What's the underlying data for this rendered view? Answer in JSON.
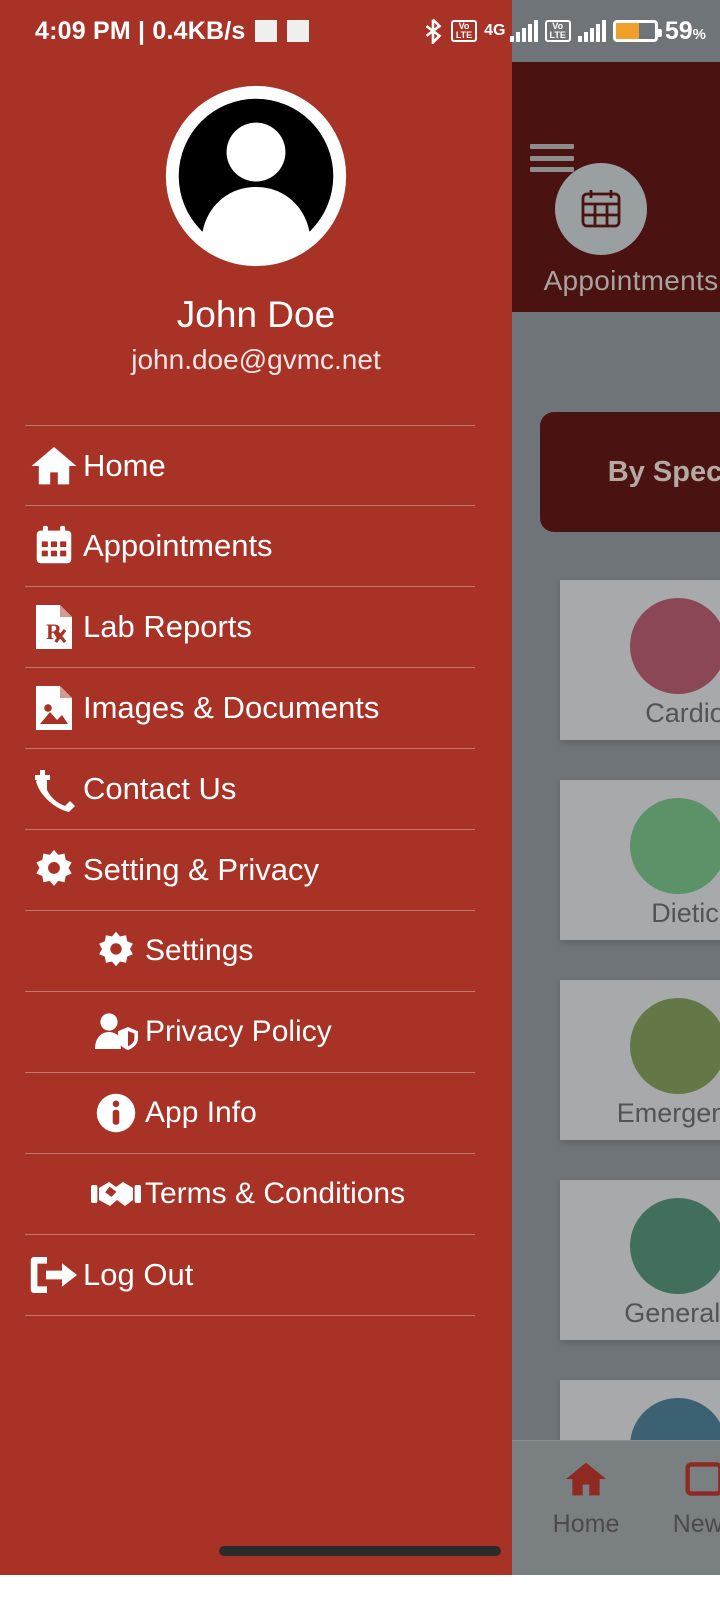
{
  "statusbar": {
    "time_and_speed": "4:09 PM | 0.4KB/s",
    "network_badge_1": "VoLTE",
    "network_gen": "4G",
    "network_badge_2": "VoLTE",
    "battery_percent": "59",
    "battery_percent_symbol": "%",
    "battery_level": 59,
    "bluetooth_icon": "bluetooth-icon"
  },
  "drawer": {
    "accent_color": "#a93226",
    "divider_color": "#c0776d",
    "profile": {
      "avatar": "user-avatar",
      "name": "John Doe",
      "email": "john.doe@gvmc.net"
    },
    "menu": [
      {
        "label": "Home",
        "icon": "home-icon",
        "sub": false
      },
      {
        "label": "Appointments",
        "icon": "calendar-icon",
        "sub": false
      },
      {
        "label": "Lab Reports",
        "icon": "prescription-icon",
        "sub": false
      },
      {
        "label": "Images & Documents",
        "icon": "image-file-icon",
        "sub": false
      },
      {
        "label": "Contact Us",
        "icon": "phone-plus-icon",
        "sub": false
      },
      {
        "label": "Setting & Privacy",
        "icon": "gear-icon",
        "sub": false
      },
      {
        "label": "Settings",
        "icon": "gear-icon",
        "sub": true
      },
      {
        "label": "Privacy Policy",
        "icon": "person-shield-icon",
        "sub": true
      },
      {
        "label": "App Info",
        "icon": "info-circle-icon",
        "sub": true
      },
      {
        "label": "Terms & Conditions",
        "icon": "handshake-icon",
        "sub": true
      },
      {
        "label": "Log Out",
        "icon": "logout-icon",
        "sub": false
      }
    ]
  },
  "background_app": {
    "menu_icon": "hamburger-icon",
    "header_icon": "calendar-icon",
    "header_title": "Appointments",
    "filter_button": "By Spec",
    "filter_button_full": "By Speciality",
    "specialty_cards": [
      {
        "label": "Cardio",
        "icon": "heart-icon",
        "color": "#a3243a"
      },
      {
        "label": "Dietic",
        "icon": "apple-icon",
        "color": "#4aa martin"
      },
      {
        "label": "Emergency",
        "icon": "hospital-bed-icon",
        "color": "#5d7a1f"
      },
      {
        "label": "General P",
        "icon": "doctor-icon",
        "color": "#1f6b46"
      },
      {
        "label": "",
        "icon": "circle-icon",
        "color": "#0f4c66"
      }
    ],
    "bottom_nav": [
      {
        "label": "Home",
        "icon": "home-icon",
        "active": true
      },
      {
        "label": "News",
        "icon": "news-icon",
        "active": false
      }
    ]
  }
}
